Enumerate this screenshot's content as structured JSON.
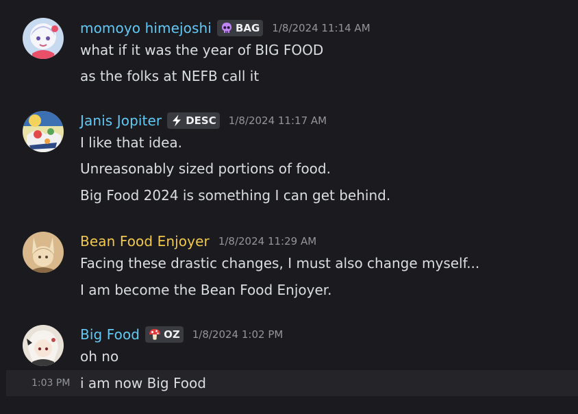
{
  "colors": {
    "background": "#1b1b1f",
    "hover_row": "#242429",
    "message_text": "#dbdee1",
    "timestamp": "#94959c",
    "tag_background": "#3a3b41",
    "name_blue": "#62c8f5",
    "name_yellow": "#f2c94c"
  },
  "messages": [
    {
      "username": "momoyo himejoshi",
      "name_color": "#62c8f5",
      "avatar_icon": "anime-girl-avatar-icon",
      "tag": {
        "icon": "skull-icon",
        "label": "BAG"
      },
      "timestamp": "1/8/2024 11:14 AM",
      "lines": [
        "what if it was the year of BIG FOOD",
        "as the folks at NEFB call it"
      ]
    },
    {
      "username": "Janis Jopiter",
      "name_color": "#62c8f5",
      "avatar_icon": "colorful-illustration-avatar-icon",
      "tag": {
        "icon": "lightning-icon",
        "label": "DESC"
      },
      "timestamp": "1/8/2024 11:17 AM",
      "lines": [
        "I like that idea.",
        "Unreasonably sized portions of food.",
        "Big Food 2024 is something I can get behind."
      ]
    },
    {
      "username": "Bean Food Enjoyer",
      "name_color": "#f2c94c",
      "avatar_icon": "beige-character-avatar-icon",
      "tag": null,
      "timestamp": "1/8/2024 11:29 AM",
      "lines": [
        "Facing these drastic changes, I must also change myself...",
        "I am become the Bean Food Enjoyer."
      ]
    },
    {
      "username": "Big Food",
      "name_color": "#62c8f5",
      "avatar_icon": "white-haired-girl-avatar-icon",
      "tag": {
        "icon": "mushroom-icon",
        "label": "OZ"
      },
      "timestamp": "1/8/2024 1:02 PM",
      "lines": [
        "oh no"
      ]
    }
  ],
  "followup": {
    "time": "1:03 PM",
    "text": "i am now Big Food"
  }
}
